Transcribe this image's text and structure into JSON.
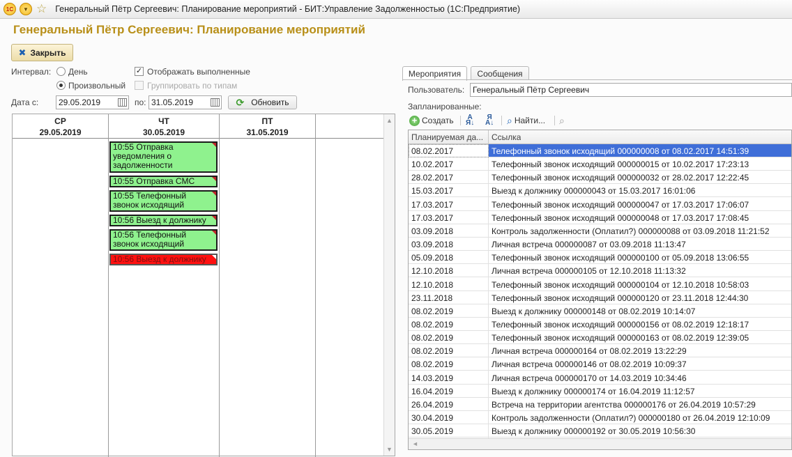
{
  "window": {
    "title": "Генеральный Пётр Сергеевич: Планирование мероприятий - БИТ:Управление Задолженностью  (1С:Предприятие)",
    "logo_text": "1С"
  },
  "page_title": "Генеральный Пётр Сергеевич: Планирование мероприятий",
  "close_button": "Закрыть",
  "filters": {
    "interval_label": "Интервал:",
    "radio_day": "День",
    "radio_custom": "Произвольный",
    "show_done": "Отображать выполненные",
    "group_by_type": "Группировать по типам",
    "date_from_label": "Дата с:",
    "date_from": "29.05.2019",
    "date_to_label": "по:",
    "date_to": "31.05.2019",
    "refresh": "Обновить"
  },
  "calendar": {
    "days": [
      {
        "dow": "СР",
        "date": "29.05.2019"
      },
      {
        "dow": "ЧТ",
        "date": "30.05.2019"
      },
      {
        "dow": "ПТ",
        "date": "31.05.2019"
      }
    ],
    "events": [
      {
        "text": "10:55 Отправка уведомления о задолженности",
        "status": "ok"
      },
      {
        "text": "10:55 Отправка СМС",
        "status": "ok"
      },
      {
        "text": "10:55 Телефонный звонок исходящий",
        "status": "ok"
      },
      {
        "text": "10:56 Выезд к должнику",
        "status": "ok"
      },
      {
        "text": "10:56 Телефонный звонок исходящий",
        "status": "ok"
      },
      {
        "text": "10:56 Выезд к должнику",
        "status": "overdue"
      }
    ]
  },
  "tabs": [
    "Мероприятия",
    "Сообщения"
  ],
  "user_label": "Пользователь:",
  "user_value": "Генеральный Пётр Сергеевич",
  "planned_label": "Запланированные:",
  "toolbar": {
    "create": "Создать",
    "find": "Найти..."
  },
  "table": {
    "headers": [
      "Планируемая да...",
      "Ссылка"
    ],
    "rows": [
      [
        "08.02.2017",
        "Телефонный звонок исходящий 000000008 от 08.02.2017 14:51:39"
      ],
      [
        "10.02.2017",
        "Телефонный звонок исходящий 000000015 от 10.02.2017 17:23:13"
      ],
      [
        "28.02.2017",
        "Телефонный звонок исходящий 000000032 от 28.02.2017 12:22:45"
      ],
      [
        "15.03.2017",
        "Выезд к должнику 000000043 от 15.03.2017 16:01:06"
      ],
      [
        "17.03.2017",
        "Телефонный звонок исходящий 000000047 от 17.03.2017 17:06:07"
      ],
      [
        "17.03.2017",
        "Телефонный звонок исходящий 000000048 от 17.03.2017 17:08:45"
      ],
      [
        "03.09.2018",
        "Контроль задолженности (Оплатил?) 000000088 от 03.09.2018 11:21:52"
      ],
      [
        "03.09.2018",
        "Личная встреча 000000087 от 03.09.2018 11:13:47"
      ],
      [
        "05.09.2018",
        "Телефонный звонок исходящий 000000100 от 05.09.2018 13:06:55"
      ],
      [
        "12.10.2018",
        "Личная встреча 000000105 от 12.10.2018 11:13:32"
      ],
      [
        "12.10.2018",
        "Телефонный звонок исходящий 000000104 от 12.10.2018 10:58:03"
      ],
      [
        "23.11.2018",
        "Телефонный звонок исходящий 000000120 от 23.11.2018 12:44:30"
      ],
      [
        "08.02.2019",
        "Выезд к должнику 000000148 от 08.02.2019 10:14:07"
      ],
      [
        "08.02.2019",
        "Телефонный звонок исходящий 000000156 от 08.02.2019 12:18:17"
      ],
      [
        "08.02.2019",
        "Телефонный звонок исходящий 000000163 от 08.02.2019 12:39:05"
      ],
      [
        "08.02.2019",
        "Личная встреча 000000164 от 08.02.2019 13:22:29"
      ],
      [
        "08.02.2019",
        "Личная встреча 000000146 от 08.02.2019 10:09:37"
      ],
      [
        "14.03.2019",
        "Личная встреча 000000170 от 14.03.2019 10:34:46"
      ],
      [
        "16.04.2019",
        "Выезд к должнику 000000174 от 16.04.2019 11:12:57"
      ],
      [
        "26.04.2019",
        "Встреча на территории агентства 000000176 от 26.04.2019 10:57:29"
      ],
      [
        "30.04.2019",
        "Контроль задолженности (Оплатил?) 000000180 от 26.04.2019 12:10:09"
      ],
      [
        "30.05.2019",
        "Выезд к должнику 000000192 от 30.05.2019 10:56:30"
      ]
    ],
    "selected_row": 0
  },
  "colors": {
    "title_gold": "#b88f18",
    "event_green": "#8ff28e",
    "event_red": "#ff1010",
    "selection_blue": "#3f6ed8"
  }
}
